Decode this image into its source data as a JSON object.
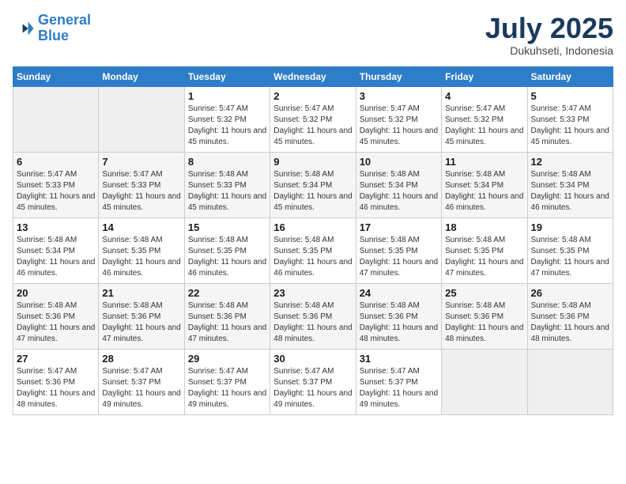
{
  "header": {
    "logo_line1": "General",
    "logo_line2": "Blue",
    "month_title": "July 2025",
    "location": "Dukuhseti, Indonesia"
  },
  "days_of_week": [
    "Sunday",
    "Monday",
    "Tuesday",
    "Wednesday",
    "Thursday",
    "Friday",
    "Saturday"
  ],
  "weeks": [
    [
      {
        "day": "",
        "sunrise": "",
        "sunset": "",
        "daylight": "",
        "empty": true
      },
      {
        "day": "",
        "sunrise": "",
        "sunset": "",
        "daylight": "",
        "empty": true
      },
      {
        "day": "1",
        "sunrise": "Sunrise: 5:47 AM",
        "sunset": "Sunset: 5:32 PM",
        "daylight": "Daylight: 11 hours and 45 minutes."
      },
      {
        "day": "2",
        "sunrise": "Sunrise: 5:47 AM",
        "sunset": "Sunset: 5:32 PM",
        "daylight": "Daylight: 11 hours and 45 minutes."
      },
      {
        "day": "3",
        "sunrise": "Sunrise: 5:47 AM",
        "sunset": "Sunset: 5:32 PM",
        "daylight": "Daylight: 11 hours and 45 minutes."
      },
      {
        "day": "4",
        "sunrise": "Sunrise: 5:47 AM",
        "sunset": "Sunset: 5:32 PM",
        "daylight": "Daylight: 11 hours and 45 minutes."
      },
      {
        "day": "5",
        "sunrise": "Sunrise: 5:47 AM",
        "sunset": "Sunset: 5:33 PM",
        "daylight": "Daylight: 11 hours and 45 minutes."
      }
    ],
    [
      {
        "day": "6",
        "sunrise": "Sunrise: 5:47 AM",
        "sunset": "Sunset: 5:33 PM",
        "daylight": "Daylight: 11 hours and 45 minutes."
      },
      {
        "day": "7",
        "sunrise": "Sunrise: 5:47 AM",
        "sunset": "Sunset: 5:33 PM",
        "daylight": "Daylight: 11 hours and 45 minutes."
      },
      {
        "day": "8",
        "sunrise": "Sunrise: 5:48 AM",
        "sunset": "Sunset: 5:33 PM",
        "daylight": "Daylight: 11 hours and 45 minutes."
      },
      {
        "day": "9",
        "sunrise": "Sunrise: 5:48 AM",
        "sunset": "Sunset: 5:34 PM",
        "daylight": "Daylight: 11 hours and 45 minutes."
      },
      {
        "day": "10",
        "sunrise": "Sunrise: 5:48 AM",
        "sunset": "Sunset: 5:34 PM",
        "daylight": "Daylight: 11 hours and 46 minutes."
      },
      {
        "day": "11",
        "sunrise": "Sunrise: 5:48 AM",
        "sunset": "Sunset: 5:34 PM",
        "daylight": "Daylight: 11 hours and 46 minutes."
      },
      {
        "day": "12",
        "sunrise": "Sunrise: 5:48 AM",
        "sunset": "Sunset: 5:34 PM",
        "daylight": "Daylight: 11 hours and 46 minutes."
      }
    ],
    [
      {
        "day": "13",
        "sunrise": "Sunrise: 5:48 AM",
        "sunset": "Sunset: 5:34 PM",
        "daylight": "Daylight: 11 hours and 46 minutes."
      },
      {
        "day": "14",
        "sunrise": "Sunrise: 5:48 AM",
        "sunset": "Sunset: 5:35 PM",
        "daylight": "Daylight: 11 hours and 46 minutes."
      },
      {
        "day": "15",
        "sunrise": "Sunrise: 5:48 AM",
        "sunset": "Sunset: 5:35 PM",
        "daylight": "Daylight: 11 hours and 46 minutes."
      },
      {
        "day": "16",
        "sunrise": "Sunrise: 5:48 AM",
        "sunset": "Sunset: 5:35 PM",
        "daylight": "Daylight: 11 hours and 46 minutes."
      },
      {
        "day": "17",
        "sunrise": "Sunrise: 5:48 AM",
        "sunset": "Sunset: 5:35 PM",
        "daylight": "Daylight: 11 hours and 47 minutes."
      },
      {
        "day": "18",
        "sunrise": "Sunrise: 5:48 AM",
        "sunset": "Sunset: 5:35 PM",
        "daylight": "Daylight: 11 hours and 47 minutes."
      },
      {
        "day": "19",
        "sunrise": "Sunrise: 5:48 AM",
        "sunset": "Sunset: 5:35 PM",
        "daylight": "Daylight: 11 hours and 47 minutes."
      }
    ],
    [
      {
        "day": "20",
        "sunrise": "Sunrise: 5:48 AM",
        "sunset": "Sunset: 5:36 PM",
        "daylight": "Daylight: 11 hours and 47 minutes."
      },
      {
        "day": "21",
        "sunrise": "Sunrise: 5:48 AM",
        "sunset": "Sunset: 5:36 PM",
        "daylight": "Daylight: 11 hours and 47 minutes."
      },
      {
        "day": "22",
        "sunrise": "Sunrise: 5:48 AM",
        "sunset": "Sunset: 5:36 PM",
        "daylight": "Daylight: 11 hours and 47 minutes."
      },
      {
        "day": "23",
        "sunrise": "Sunrise: 5:48 AM",
        "sunset": "Sunset: 5:36 PM",
        "daylight": "Daylight: 11 hours and 48 minutes."
      },
      {
        "day": "24",
        "sunrise": "Sunrise: 5:48 AM",
        "sunset": "Sunset: 5:36 PM",
        "daylight": "Daylight: 11 hours and 48 minutes."
      },
      {
        "day": "25",
        "sunrise": "Sunrise: 5:48 AM",
        "sunset": "Sunset: 5:36 PM",
        "daylight": "Daylight: 11 hours and 48 minutes."
      },
      {
        "day": "26",
        "sunrise": "Sunrise: 5:48 AM",
        "sunset": "Sunset: 5:36 PM",
        "daylight": "Daylight: 11 hours and 48 minutes."
      }
    ],
    [
      {
        "day": "27",
        "sunrise": "Sunrise: 5:47 AM",
        "sunset": "Sunset: 5:36 PM",
        "daylight": "Daylight: 11 hours and 48 minutes."
      },
      {
        "day": "28",
        "sunrise": "Sunrise: 5:47 AM",
        "sunset": "Sunset: 5:37 PM",
        "daylight": "Daylight: 11 hours and 49 minutes."
      },
      {
        "day": "29",
        "sunrise": "Sunrise: 5:47 AM",
        "sunset": "Sunset: 5:37 PM",
        "daylight": "Daylight: 11 hours and 49 minutes."
      },
      {
        "day": "30",
        "sunrise": "Sunrise: 5:47 AM",
        "sunset": "Sunset: 5:37 PM",
        "daylight": "Daylight: 11 hours and 49 minutes."
      },
      {
        "day": "31",
        "sunrise": "Sunrise: 5:47 AM",
        "sunset": "Sunset: 5:37 PM",
        "daylight": "Daylight: 11 hours and 49 minutes."
      },
      {
        "day": "",
        "sunrise": "",
        "sunset": "",
        "daylight": "",
        "empty": true
      },
      {
        "day": "",
        "sunrise": "",
        "sunset": "",
        "daylight": "",
        "empty": true
      }
    ]
  ]
}
